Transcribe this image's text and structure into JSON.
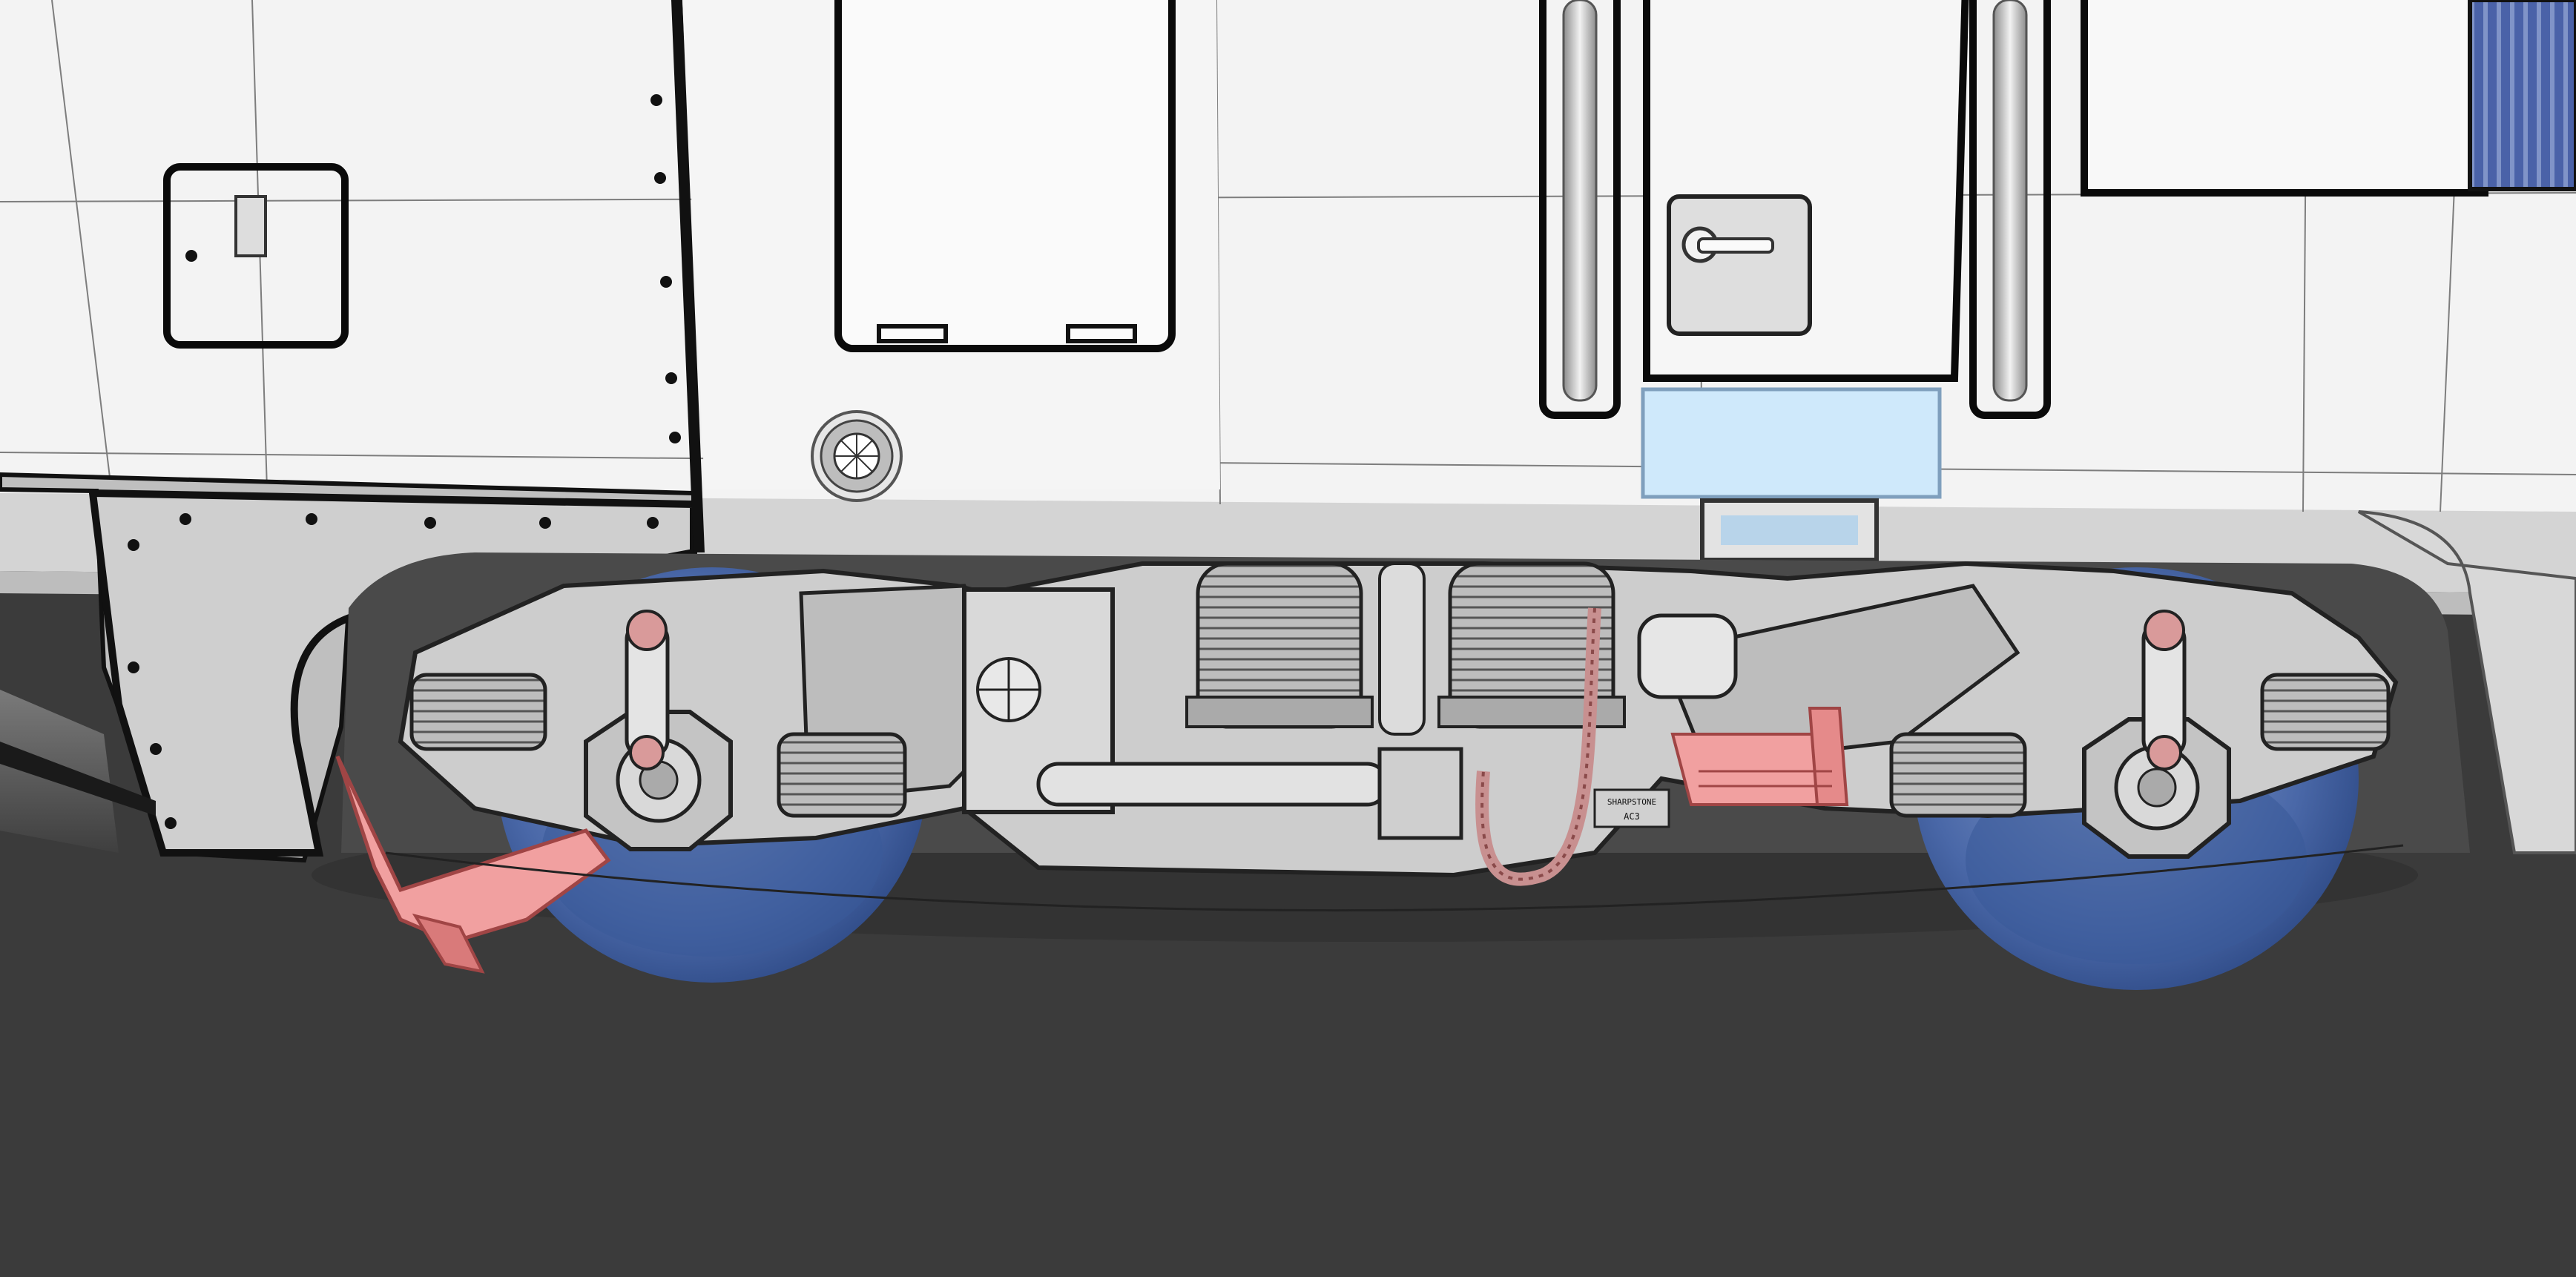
{
  "scene": {
    "plate_text_line1": "SHARPSTONE",
    "plate_text_line2": "AC3",
    "colors": {
      "body": "#f3f3f3",
      "skirt": "#cfcfcf",
      "ground": "#3b3b3b",
      "bogie": "#cdcdcd",
      "wheel": "#4a68a8",
      "step_highlight": "#f1a0a0",
      "glass": "#cfe9fb",
      "vent": "#4a62a8",
      "outline": "#000000",
      "wire": "#8a8a8a"
    }
  }
}
